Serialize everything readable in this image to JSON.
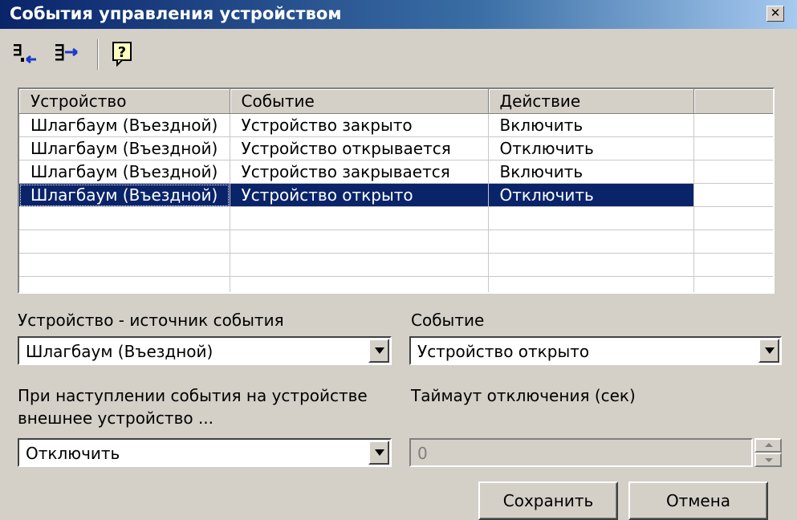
{
  "window": {
    "title": "События управления устройством"
  },
  "toolbar": {
    "icons": [
      "import-icon",
      "export-icon",
      "help-icon"
    ]
  },
  "grid": {
    "columns": [
      "Устройство",
      "Событие",
      "Действие",
      ""
    ],
    "rows": [
      {
        "device": "Шлагбаум (Въездной)",
        "event": "Устройство закрыто",
        "action": "Включить"
      },
      {
        "device": "Шлагбаум (Въездной)",
        "event": "Устройство открывается",
        "action": "Отключить"
      },
      {
        "device": "Шлагбаум (Въездной)",
        "event": "Устройство закрывается",
        "action": "Включить"
      },
      {
        "device": "Шлагбаум (Въездной)",
        "event": "Устройство открыто",
        "action": "Отключить"
      }
    ],
    "selected_row": 3
  },
  "form": {
    "source_label": "Устройство - источник события",
    "source_value": "Шлагбаум (Въездной)",
    "event_label": "Событие",
    "event_value": "Устройство открыто",
    "action_label_line1": "При наступлении события на устройстве",
    "action_label_line2": "внешнее устройство ...",
    "action_value": "Отключить",
    "timeout_label": "Таймаут отключения (сек)",
    "timeout_value": "0"
  },
  "buttons": {
    "save": "Сохранить",
    "cancel": "Отмена"
  },
  "colors": {
    "face": "#d4d0c8",
    "title_start": "#0a246a",
    "title_end": "#a6caf0",
    "selection": "#0a246a"
  }
}
